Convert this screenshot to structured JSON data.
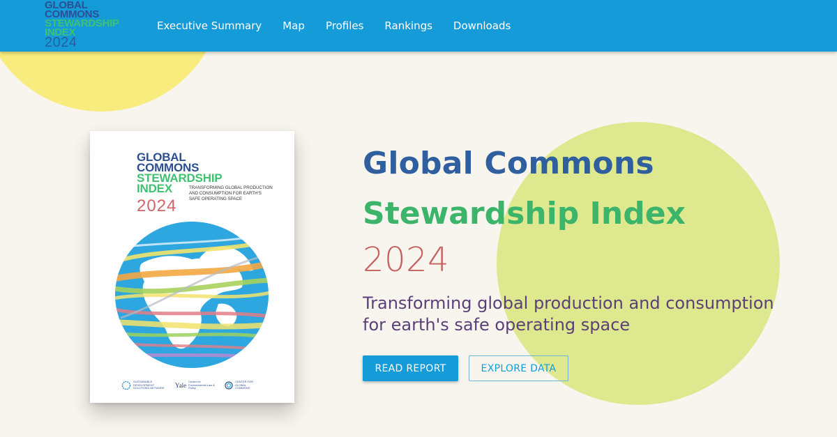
{
  "logo": {
    "line1": "GLOBAL",
    "line2": "COMMONS",
    "line3": "STEWARDSHIP",
    "line4": "INDEX",
    "line5": "2024"
  },
  "nav": {
    "items": [
      {
        "label": "Executive Summary"
      },
      {
        "label": "Map"
      },
      {
        "label": "Profiles"
      },
      {
        "label": "Rankings"
      },
      {
        "label": "Downloads"
      }
    ]
  },
  "cover": {
    "title_line1": "GLOBAL",
    "title_line2": "COMMONS",
    "title_line3": "STEWARDSHIP",
    "title_line4": "INDEX",
    "year": "2024",
    "subtitle": "TRANSFORMING GLOBAL PRODUCTION AND CONSUMPTION FOR EARTH'S SAFE OPERATING SPACE",
    "partner_logos": {
      "sdsn": "SUSTAINABLE DEVELOPMENT SOLUTIONS NETWORK",
      "yale": "Yale",
      "yale_sub": "Center for Environmental Law & Policy",
      "cgc": "CENTER FOR GLOBAL COMMONS"
    }
  },
  "hero": {
    "title_line1": "Global Commons",
    "title_line2": "Stewardship Index",
    "year": "2024",
    "subtitle": "Transforming global production and consumption for earth's safe operating space"
  },
  "buttons": {
    "read_report": "READ REPORT",
    "explore_data": "EXPLORE DATA"
  },
  "colors": {
    "header": "#169bd9",
    "background": "#f8f5ee",
    "navy": "#2f5f9e",
    "green": "#3cb56b",
    "coral": "#c5615e",
    "purple": "#5a3f79",
    "yellow_circle": "#f9ec7e",
    "green_circle": "#dde88f"
  }
}
